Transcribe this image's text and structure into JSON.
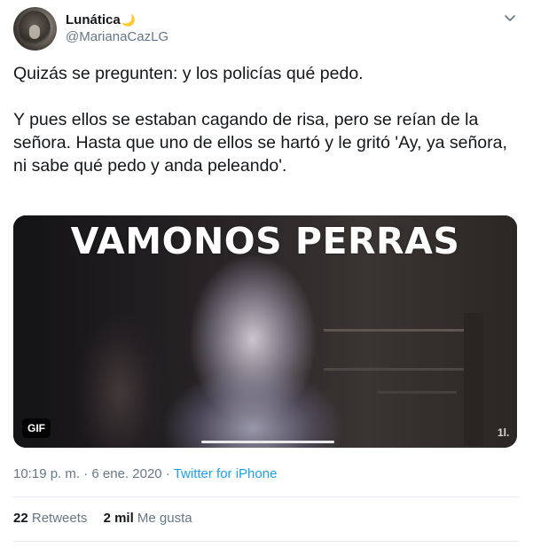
{
  "author": {
    "display_name": "Lunática",
    "name_emoji": "🌙",
    "handle": "@MarianaCazLG",
    "avatar_icon": "avatar-photo"
  },
  "tweet": {
    "text": "Quizás se pregunten: y los policías qué pedo.\n\nY pues ellos se estaban cagando de risa, pero se reían de la señora. Hasta  que uno de ellos se hartó y le gritó 'Ay, ya señora, ni sabe qué pedo y anda peleando'."
  },
  "media": {
    "caption": "VAMONOS PERRAS",
    "badge": "GIF",
    "corner_mark": "1l."
  },
  "meta": {
    "time": "10:19 p. m.",
    "separator_1": " · ",
    "date": "6 ene. 2020",
    "separator_2": " · ",
    "source": "Twitter for iPhone"
  },
  "stats": {
    "retweets_count": "22",
    "retweets_label": "Retweets",
    "likes_count": "2 mil",
    "likes_label": "Me gusta"
  },
  "colors": {
    "text": "#14171a",
    "secondary": "#657786",
    "accent": "#1da1f2",
    "divider": "#e6ecf0"
  }
}
